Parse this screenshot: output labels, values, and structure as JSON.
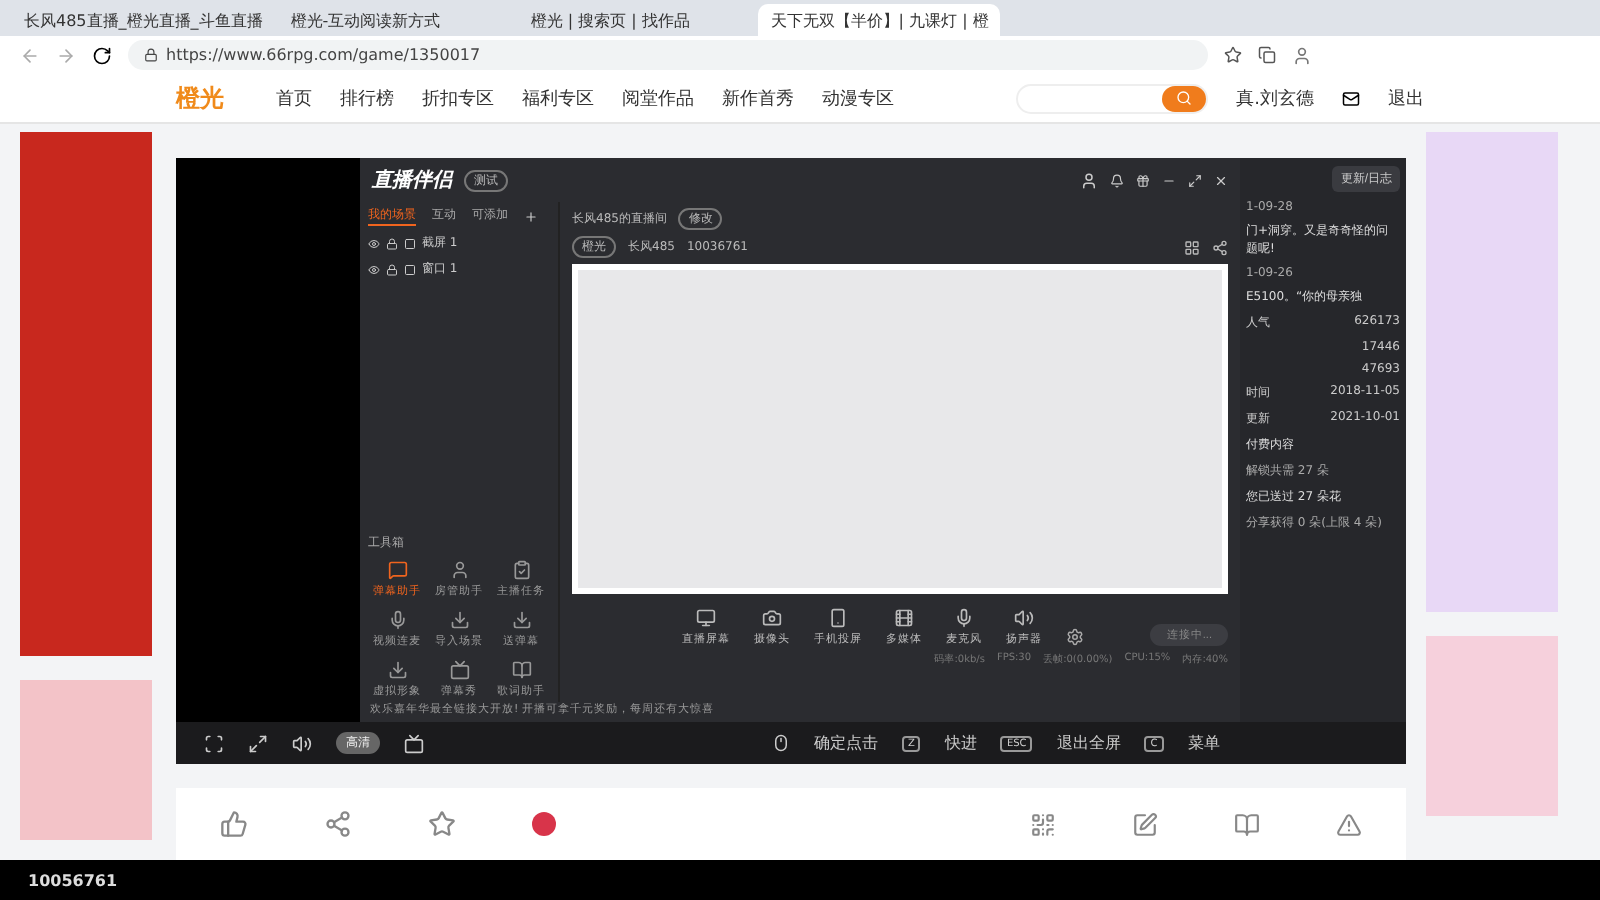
{
  "browser": {
    "tabs": [
      {
        "title": "长风485直播_橙光直播_斗鱼直播",
        "selected": false
      },
      {
        "title": "橙光-互动阅读新方式",
        "selected": false
      },
      {
        "title": "橙光 | 搜索页 | 找作品",
        "selected": false
      },
      {
        "title": "天下无双【半价】| 九课灯 | 橙",
        "selected": true
      }
    ],
    "url": "https://www.66rpg.com/game/1350017"
  },
  "site_nav": {
    "logo": "橙光",
    "links": [
      "首页",
      "排行榜",
      "折扣专区",
      "福利专区",
      "阅堂作品",
      "新作首秀",
      "动漫专区"
    ],
    "user": "真.刘玄德",
    "logout": "退出"
  },
  "stream_app": {
    "logo": "直播伴侣",
    "badge": "测试",
    "tabs": [
      {
        "label": "我的场景",
        "selected": true
      },
      {
        "label": "互动",
        "selected": false
      },
      {
        "label": "可添加",
        "selected": false
      }
    ],
    "sources": [
      "截屏 1",
      "窗口 1"
    ],
    "toolbox_title": "工具箱",
    "tools": [
      {
        "label": "弹幕助手",
        "selected": true
      },
      {
        "label": "房管助手",
        "selected": false
      },
      {
        "label": "主播任务",
        "selected": false
      },
      {
        "label": "视频连麦",
        "selected": false
      },
      {
        "label": "导入场景",
        "selected": false
      },
      {
        "label": "送弹幕",
        "selected": false
      },
      {
        "label": "虚拟形象",
        "selected": false
      },
      {
        "label": "弹幕秀",
        "selected": false
      },
      {
        "label": "歌词助手",
        "selected": false
      }
    ],
    "notice": "欢乐嘉年华最全链接大开放! 开播可拿千元奖励，每周还有大惊喜",
    "room_title": "长风485的直播间",
    "edit_badge": "修改",
    "category": "橙光",
    "streamer": "长风485",
    "room_id": "10036761",
    "devices": [
      "直播屏幕",
      "摄像头",
      "手机投屏",
      "多媒体",
      "麦克风",
      "扬声器"
    ],
    "connect_button": "连接中...",
    "status": [
      "码率:0kb/s",
      "FPS:30",
      "丢帧:0(0.00%)",
      "CPU:15%",
      "内存:40%"
    ]
  },
  "info_panel": {
    "update_button": "更新/日志",
    "updates": [
      {
        "date": "1-09-28",
        "text": "门+洞穿。又是奇奇怪的问题呢!"
      },
      {
        "date": "1-09-26",
        "text": "E5100。“你的母亲独"
      }
    ],
    "stats": [
      {
        "label": "人气",
        "value": "626173"
      },
      {
        "value": "17446"
      },
      {
        "value": "47693"
      },
      {
        "label": "时间",
        "value": "2018-11-05"
      },
      {
        "label": "更新",
        "value": "2021-10-01"
      }
    ],
    "paid_title": "付费内容",
    "paid_text": "解锁共需 27 朵",
    "sent": "您已送过 27 朵花",
    "share": "分享获得 0 朵(上限 4 朵)"
  },
  "player_controls": {
    "quality": "高清",
    "hints": [
      {
        "label": "确定点击"
      },
      {
        "key": "Z",
        "label": "快进"
      },
      {
        "key": "ESC",
        "label": "退出全屏"
      },
      {
        "key": "C",
        "label": "菜单"
      }
    ]
  },
  "overlay_id": "10056761"
}
